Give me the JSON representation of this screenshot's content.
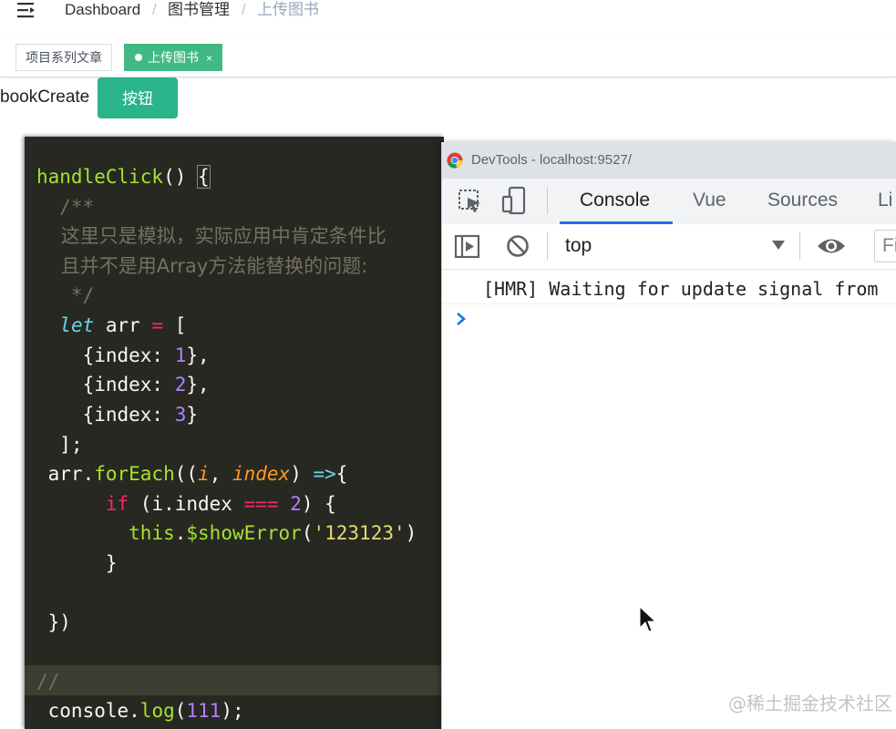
{
  "navbar": {
    "breadcrumb": [
      "Dashboard",
      "图书管理",
      "上传图书"
    ],
    "separator": "/"
  },
  "tags_view": {
    "tags": [
      {
        "label": "项目系列文章",
        "active": false
      },
      {
        "label": "上传图书",
        "active": true,
        "close": "×"
      }
    ]
  },
  "page": {
    "component_text": "bookCreate",
    "button_label": "按钮"
  },
  "editor": {
    "theme_colors": {
      "background": "#272822",
      "function": "#a6e22e",
      "keyword": "#66d9ef",
      "number": "#ae81ff",
      "string": "#e6db74",
      "comment": "#75715e"
    },
    "lines": [
      "handleClick() {",
      "  /**",
      "    这里只是模拟，实际应用中肯定条件比",
      "    且并不是用Array方法能替换的问题:",
      "   */",
      "  let arr = [",
      "    {index: 1},",
      "    {index: 2},",
      "    {index: 3}",
      "  ];",
      " arr.forEach((i, index) =>{",
      "      if (i.index === 2) {",
      "        this.$showError('123123')",
      "      }",
      "",
      " })",
      "",
      "//",
      " console.log(111);"
    ]
  },
  "devtools": {
    "window_title": "DevTools - localhost:9527/",
    "tabs": [
      "Console",
      "Vue",
      "Sources",
      "Li"
    ],
    "active_tab": "Console",
    "context": "top",
    "filter_placeholder": "Fi",
    "messages": [
      "[HMR] Waiting for update signal from"
    ],
    "prompt": "›"
  },
  "watermark": "@稀土掘金技术社区"
}
